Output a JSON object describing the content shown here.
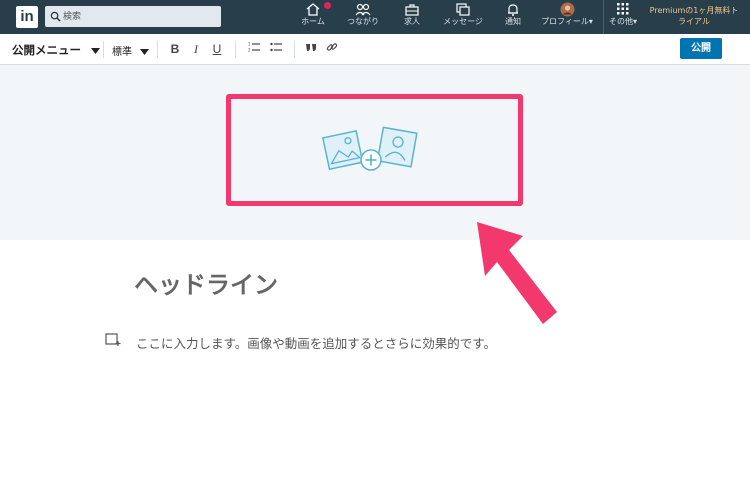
{
  "nav": {
    "logo": "in",
    "search_placeholder": "検索",
    "items": [
      {
        "label": "ホーム",
        "icon": "home-icon"
      },
      {
        "label": "つながり",
        "icon": "people-icon"
      },
      {
        "label": "求人",
        "icon": "briefcase-icon"
      },
      {
        "label": "メッセージ",
        "icon": "message-icon"
      },
      {
        "label": "通知",
        "icon": "bell-icon"
      },
      {
        "label": "プロフィール▾",
        "icon": "avatar"
      },
      {
        "label": "その他▾",
        "icon": "grid-icon"
      }
    ],
    "premium": "Premiumの1ヶ月無料トライアル"
  },
  "toolbar": {
    "publish_menu": "公開メニュー",
    "style": "標準",
    "bold": "B",
    "italic": "I",
    "underline": "U",
    "publish": "公開"
  },
  "editor": {
    "headline": "ヘッドライン",
    "body_placeholder": "ここに入力します。画像や動画を追加するとさらに効果的です。"
  },
  "colors": {
    "nav_bg": "#283e4a",
    "accent": "#0073b1",
    "highlight": "#f2386d"
  }
}
